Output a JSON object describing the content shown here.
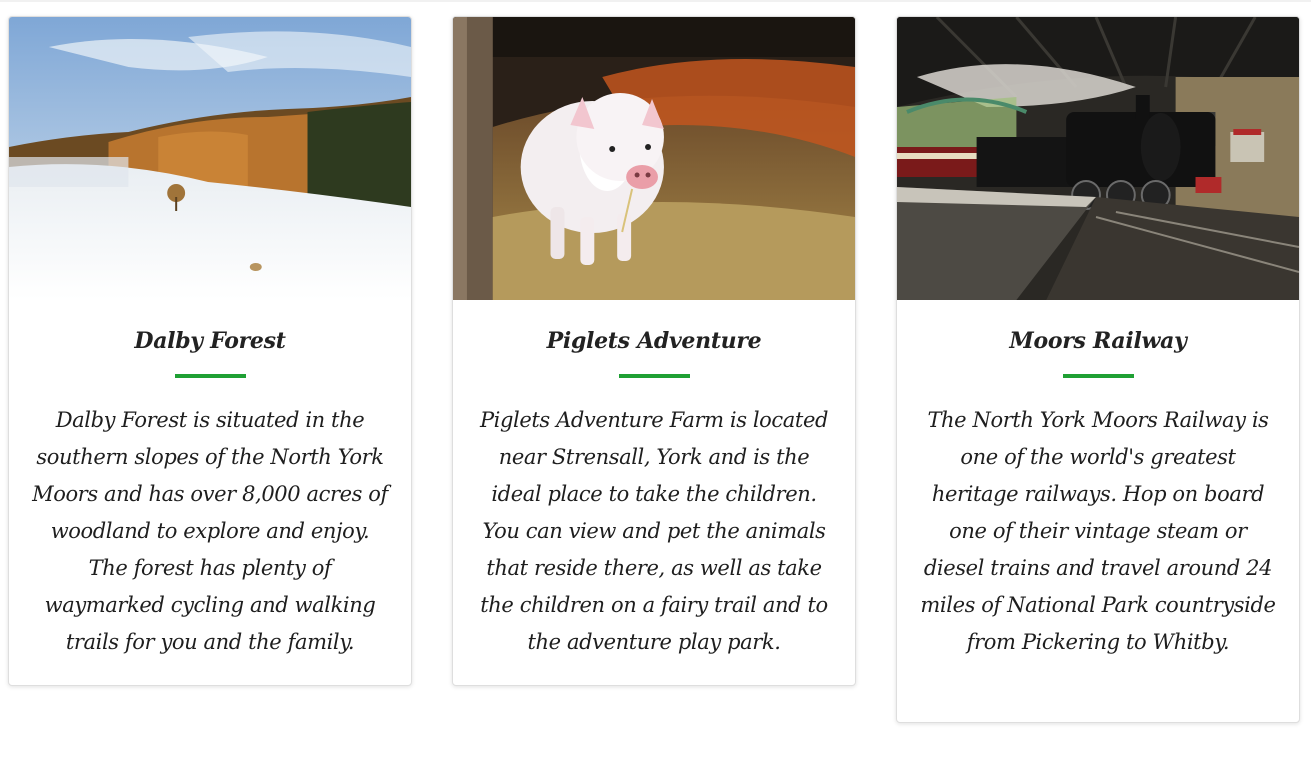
{
  "cards": [
    {
      "image_alt": "Snowy field with autumn forest on a hillside",
      "title": "Dalby Forest",
      "text": "Dalby Forest is situated in the southern slopes of the North York Moors and has over 8,000 acres of woodland to explore and enjoy. The forest has plenty of waymarked cycling and walking trails for you and the family."
    },
    {
      "image_alt": "White piglet standing in straw",
      "title": "Piglets Adventure",
      "text": "Piglets Adventure Farm is located near Strensall, York and is the ideal place to take the children. You can view and pet the animals that reside there, as well as take the children on a fairy trail and to the adventure play park."
    },
    {
      "image_alt": "Steam locomotive at a railway station platform",
      "title": "Moors Railway",
      "text": "The North York Moors Railway is one of the world's greatest heritage railways. Hop on board one of their vintage steam or diesel trains and travel around 24 miles of National Park countryside from Pickering to Whitby."
    }
  ],
  "colors": {
    "accent": "#1fa034",
    "title": "#222222",
    "text": "#1e1e1e",
    "card_border": "#dedede"
  }
}
